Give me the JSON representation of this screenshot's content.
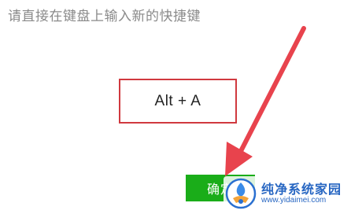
{
  "dialog": {
    "prompt": "请直接在键盘上输入新的快捷键",
    "shortcut_value": "Alt + A",
    "confirm_label": "确定"
  },
  "colors": {
    "highlight_border": "#d0393f",
    "arrow": "#e8434d",
    "confirm_bg": "#1aad19",
    "watermark_text": "#2766c2"
  },
  "watermark": {
    "title": "纯净系统家园",
    "url": "www.yidaimei.com"
  }
}
